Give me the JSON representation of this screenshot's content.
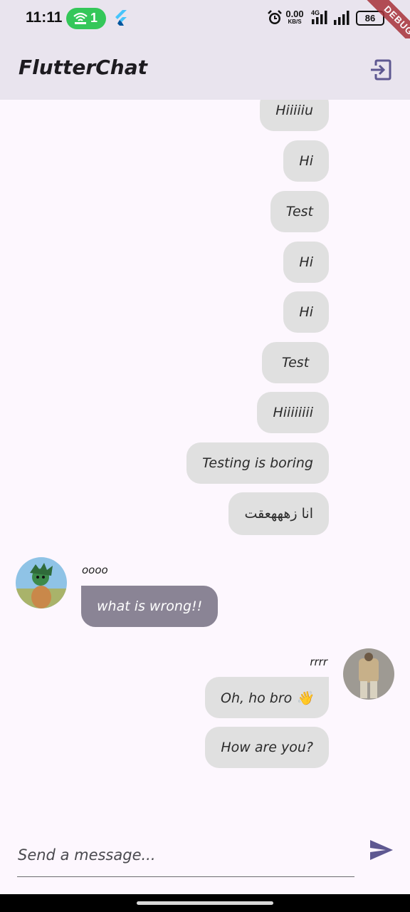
{
  "status_bar": {
    "time": "11:11",
    "hotspot_count": "1",
    "net_speed_value": "0.00",
    "net_speed_unit": "KB/S",
    "network_type": "4G",
    "battery": "86",
    "debug_banner": "DEBUG"
  },
  "app_bar": {
    "title": "FlutterChat",
    "logout_icon": "logout-icon"
  },
  "messages": [
    {
      "text": "Hiiiiiu",
      "side": "mine"
    },
    {
      "text": "Hi",
      "side": "mine"
    },
    {
      "text": "Test",
      "side": "mine"
    },
    {
      "text": "Hi",
      "side": "mine"
    },
    {
      "text": "Hi",
      "side": "mine"
    },
    {
      "text": "Test",
      "side": "mine"
    },
    {
      "text": "Hiiiiiiii",
      "side": "mine"
    },
    {
      "text": "Testing is boring",
      "side": "mine"
    },
    {
      "text": "انا زهههعقت",
      "side": "mine"
    },
    {
      "text": "what is wrong!!",
      "side": "theirs",
      "username": "oooo"
    },
    {
      "text": "Oh, ho bro 👋",
      "side": "mine",
      "username": "rrrr"
    },
    {
      "text": "How are you?",
      "side": "mine"
    }
  ],
  "composer": {
    "placeholder": "Send a message...",
    "value": "",
    "send_icon": "send-icon"
  },
  "colors": {
    "background": "#fdf7fe",
    "app_bar": "#e9e4ee",
    "my_bubble": "#e0e0e0",
    "their_bubble": "#8a8495",
    "accent": "#5e5891",
    "hotspot": "#34c759"
  }
}
